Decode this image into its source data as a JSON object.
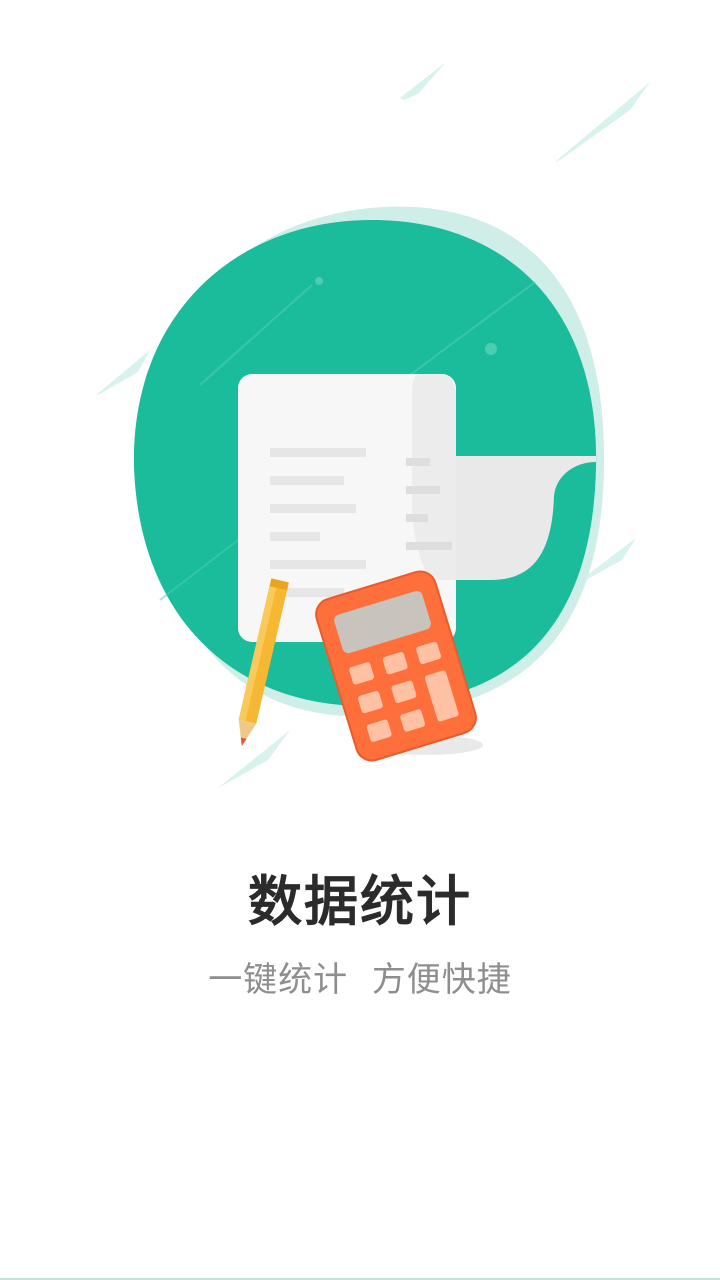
{
  "onboarding": {
    "title": "数据统计",
    "subtitle_part1": "一键统计",
    "subtitle_part2": "方便快捷"
  },
  "colors": {
    "brand_green": "#1bbc9b",
    "light_mint": "#d8f2ed",
    "calculator": "#ff6f3c",
    "pencil": "#f6b733",
    "paper": "#f6f6f6",
    "title_text": "#2b2b2b",
    "subtitle_text": "#8e8e8e"
  },
  "icons": {
    "document": "document-icon",
    "calculator": "calculator-icon",
    "pencil": "pencil-icon"
  }
}
